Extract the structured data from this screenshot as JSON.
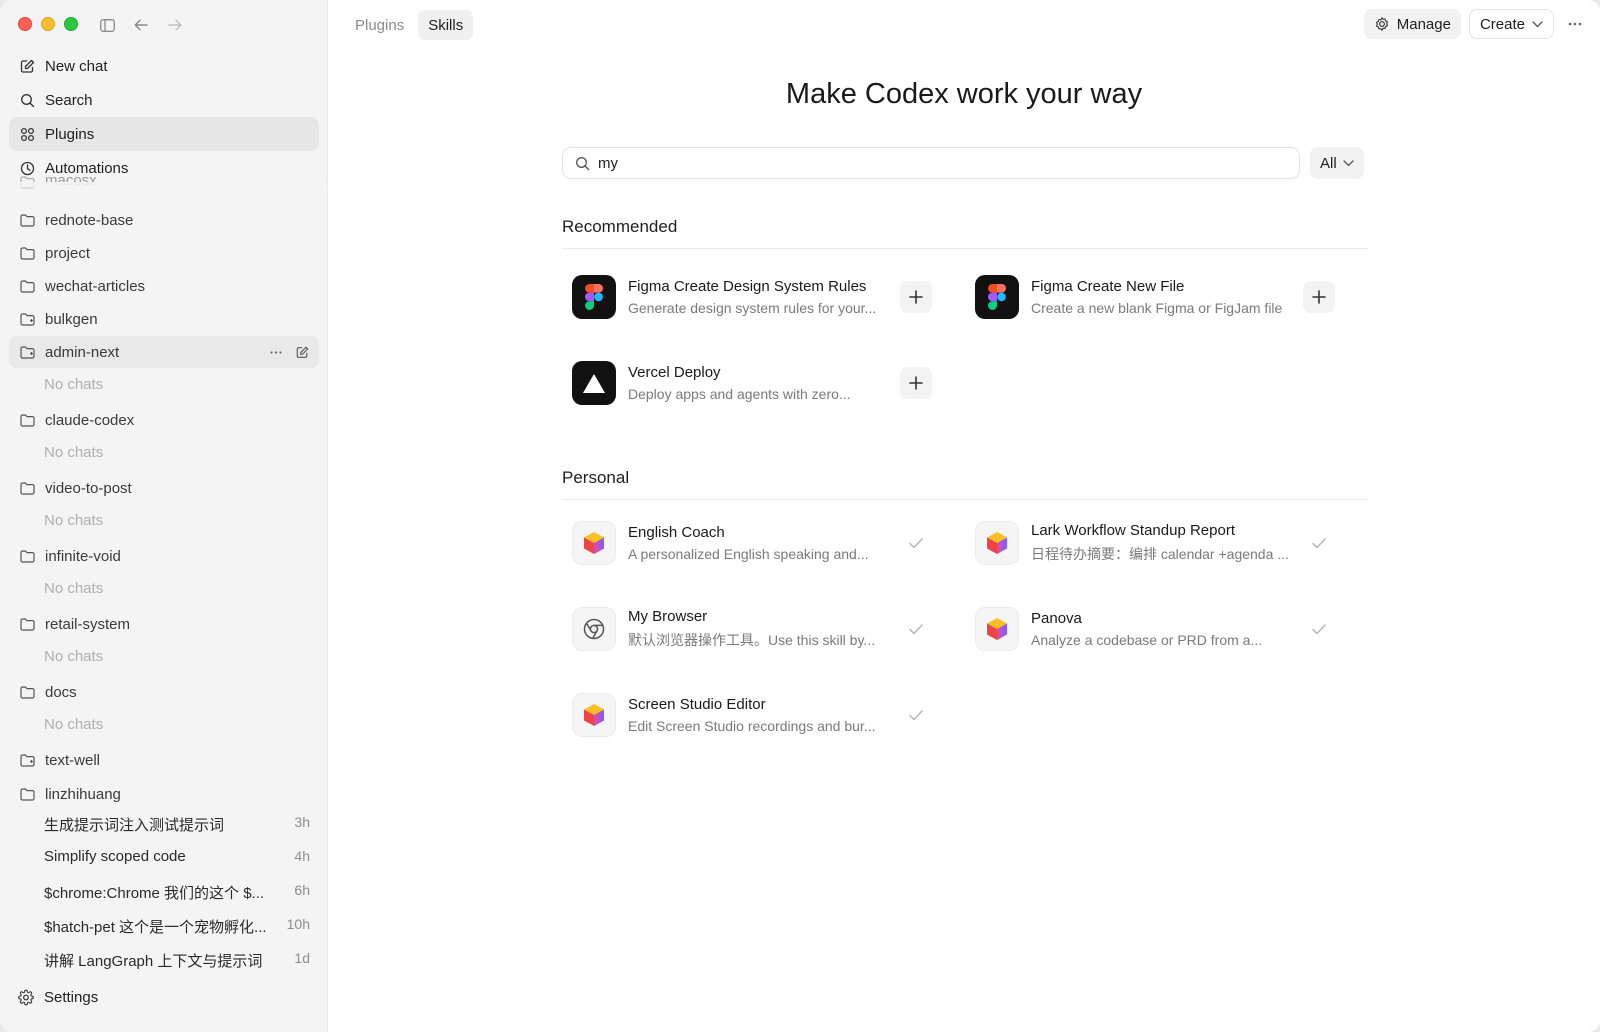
{
  "sidebar": {
    "nav": [
      {
        "label": "New chat",
        "icon": "compose-icon"
      },
      {
        "label": "Search",
        "icon": "search-icon"
      },
      {
        "label": "Plugins",
        "icon": "grid-icon"
      },
      {
        "label": "Automations",
        "icon": "clock-icon"
      }
    ],
    "partial_folder": "macosx",
    "folders": [
      {
        "label": "rednote-base"
      },
      {
        "label": "project"
      },
      {
        "label": "wechat-articles"
      },
      {
        "label": "bulkgen"
      },
      {
        "label": "admin-next"
      },
      {
        "label": "claude-codex"
      },
      {
        "label": "video-to-post"
      },
      {
        "label": "infinite-void"
      },
      {
        "label": "retail-system"
      },
      {
        "label": "docs"
      },
      {
        "label": "text-well"
      },
      {
        "label": "linzhihuang"
      }
    ],
    "no_chats_label": "No chats",
    "chats": [
      {
        "title": "生成提示词注入测试提示词",
        "age": "3h"
      },
      {
        "title": "Simplify scoped code",
        "age": "4h"
      },
      {
        "title": "$chrome:Chrome 我们的这个 $...",
        "age": "6h"
      },
      {
        "title": "$hatch-pet 这个是一个宠物孵化...",
        "age": "10h"
      },
      {
        "title": "讲解 LangGraph 上下文与提示词",
        "age": "1d"
      }
    ],
    "settings_label": "Settings"
  },
  "header": {
    "tabs": [
      {
        "label": "Plugins"
      },
      {
        "label": "Skills"
      }
    ],
    "manage_label": "Manage",
    "create_label": "Create"
  },
  "main": {
    "title": "Make Codex work your way",
    "search_value": "my",
    "filter_label": "All",
    "recommended_title": "Recommended",
    "personal_title": "Personal",
    "recommended": [
      {
        "name": "Figma Create Design System Rules",
        "desc": "Generate design system rules for your...",
        "icon": "figma-icon"
      },
      {
        "name": "Figma Create New File",
        "desc": "Create a new blank Figma or FigJam file",
        "icon": "figma-icon"
      },
      {
        "name": "Vercel Deploy",
        "desc": "Deploy apps and agents with zero...",
        "icon": "vercel-icon"
      }
    ],
    "personal": [
      {
        "name": "English Coach",
        "desc": "A personalized English speaking and...",
        "icon": "cube-icon"
      },
      {
        "name": "Lark Workflow Standup Report",
        "desc": "日程待办摘要：编排 calendar +agenda ...",
        "icon": "cube-icon"
      },
      {
        "name": "My Browser",
        "desc": "默认浏览器操作工具。Use this skill by...",
        "icon": "chrome-icon"
      },
      {
        "name": "Panova",
        "desc": "Analyze a codebase or PRD from a...",
        "icon": "cube-icon"
      },
      {
        "name": "Screen Studio Editor",
        "desc": "Edit Screen Studio recordings and bur...",
        "icon": "cube-icon"
      }
    ]
  }
}
